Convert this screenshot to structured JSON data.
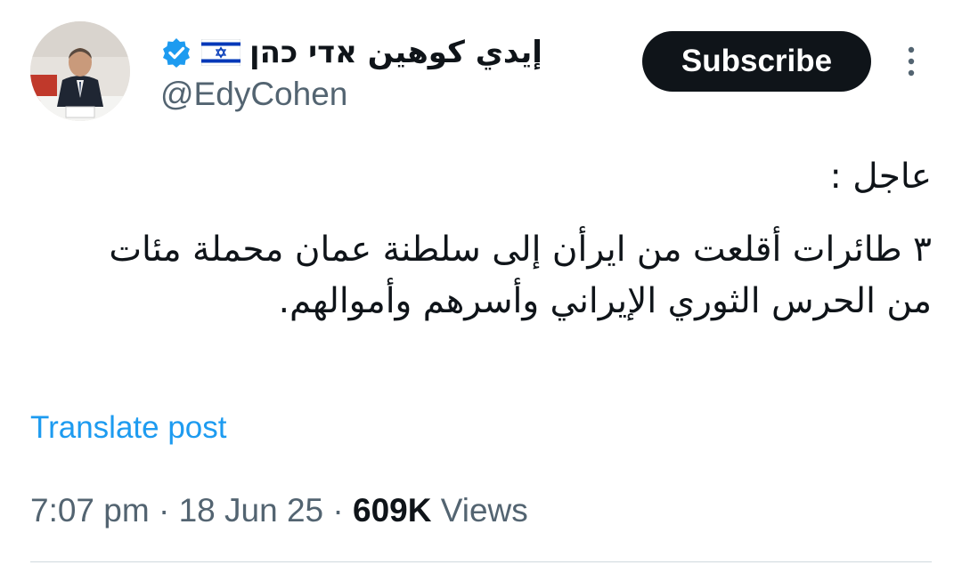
{
  "author": {
    "display_name": "إيدي كوهين אדי כהן",
    "handle": "@EdyCohen",
    "flag": "israel-flag",
    "verified": true
  },
  "actions": {
    "subscribe_label": "Subscribe"
  },
  "post": {
    "lines": [
      "عاجل :",
      "٣ طائرات أقلعت من ايرأن إلى سلطنة عمان محملة مئات",
      "من الحرس الثوري الإيراني وأسرهم وأموالهم."
    ]
  },
  "translate_label": "Translate post",
  "meta": {
    "time": "7:07 pm",
    "separator": "·",
    "date": "18 Jun 25",
    "views_count": "609K",
    "views_label": "Views"
  },
  "colors": {
    "text": "#0f1419",
    "secondary": "#536471",
    "link": "#1d9bf0",
    "verified": "#1d9bf0",
    "button_bg": "#0f1419",
    "divider": "#cfd9de"
  }
}
